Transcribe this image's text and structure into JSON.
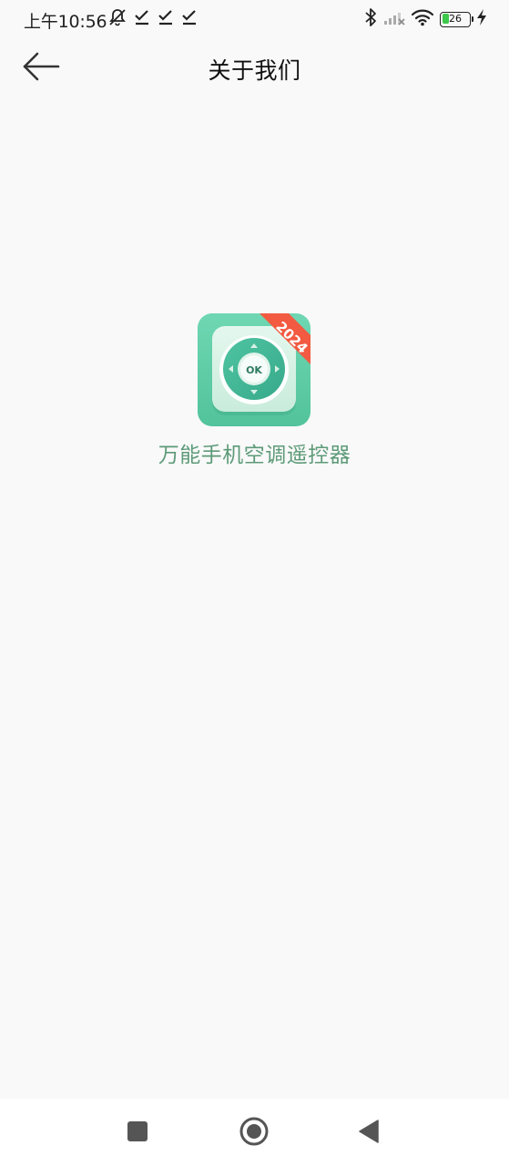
{
  "status_bar": {
    "time": "上午10:56",
    "battery_level": "26",
    "battery_fraction": 0.26,
    "charging": true
  },
  "header": {
    "title": "关于我们",
    "back_icon": "arrow-left-icon"
  },
  "app": {
    "name": "万能手机空调遥控器",
    "logo_ribbon_text": "2024",
    "logo_center_text": "OK"
  },
  "nav_bar": {
    "icons": [
      "recent-apps-icon",
      "home-icon",
      "back-triangle-icon"
    ]
  },
  "colors": {
    "background": "#f9f9f9",
    "app_name": "#5d9a78",
    "logo_green": "#5fd0a8",
    "ribbon_red": "#f25a41"
  }
}
